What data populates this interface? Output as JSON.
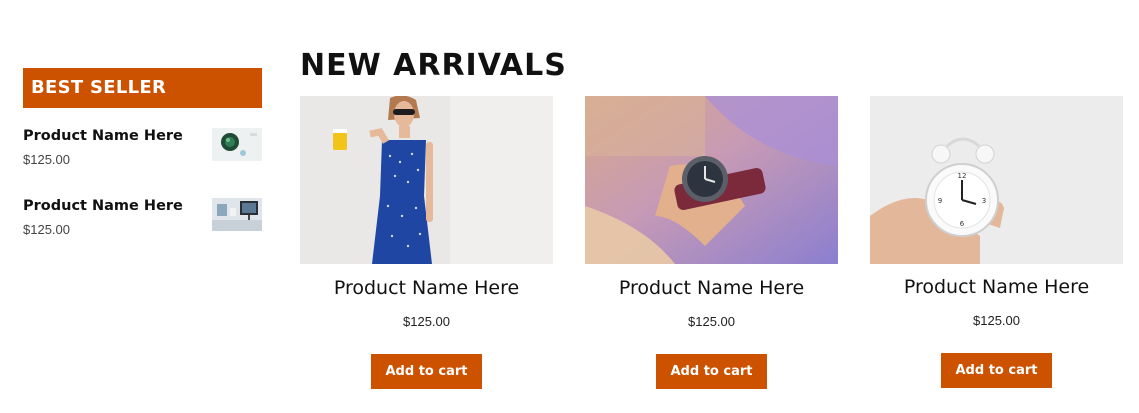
{
  "best_seller": {
    "title": "BEST SELLER",
    "items": [
      {
        "name": "Product Name Here",
        "price": "$125.00",
        "image": "plant-desk-thumbnail"
      },
      {
        "name": "Product Name Here",
        "price": "$125.00",
        "image": "office-monitor-thumbnail"
      }
    ]
  },
  "new_arrivals": {
    "title": "NEW ARRIVALS",
    "products": [
      {
        "name": "Product Name Here",
        "price": "$125.00",
        "button": "Add to cart",
        "image": "woman-blue-dress-photo"
      },
      {
        "name": "Product Name Here",
        "price": "$125.00",
        "button": "Add to cart",
        "image": "wristwatch-photo"
      },
      {
        "name": "Product Name Here",
        "price": "$125.00",
        "button": "Add to cart",
        "image": "alarm-clock-photo"
      }
    ]
  },
  "colors": {
    "accent": "#cc5200",
    "text": "#111111",
    "background": "#ffffff"
  }
}
